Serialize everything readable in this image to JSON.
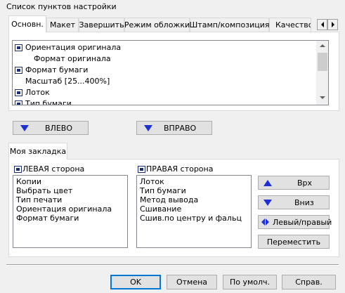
{
  "window": {
    "section_label": "Список пунктов настройки"
  },
  "tabs": [
    {
      "label": "Основн."
    },
    {
      "label": "Макет"
    },
    {
      "label": "Завершить"
    },
    {
      "label": "Режим обложки"
    },
    {
      "label": "Штамп/композиция"
    },
    {
      "label": "Качество"
    }
  ],
  "tab_scroll": {
    "left_icon": "chevron-left-icon",
    "right_icon": "chevron-right-icon"
  },
  "settings_list": {
    "items": [
      {
        "label": "Ориентация оригинала",
        "icon": "setting-item-icon"
      },
      {
        "label": "Формат оригинала",
        "icon": ""
      },
      {
        "label": "Формат бумаги",
        "icon": "setting-item-icon"
      },
      {
        "label": "Масштаб [25...400%]",
        "icon": ""
      },
      {
        "label": "Лоток",
        "icon": "setting-item-icon"
      },
      {
        "label": "Тип бумаги",
        "icon": "setting-item-icon"
      }
    ]
  },
  "move_buttons": {
    "left_label": "ВЛЕВО",
    "right_label": "ВПРАВО"
  },
  "bookmark": {
    "tab_label": "Моя закладка",
    "left_title": "ЛЕВАЯ сторона",
    "right_title": "ПРАВАЯ сторона",
    "left_items": [
      "Копии",
      "Выбрать цвет",
      "Тип печати",
      "Ориентация оригинала",
      "Формат бумаги"
    ],
    "right_items": [
      "Лоток",
      "Тип бумаги",
      "Метод вывода",
      "Сшивание",
      "Сшив.по центру и фальц"
    ],
    "up_label": "Врх",
    "down_label": "Вниз",
    "swap_label": "Левый/правый",
    "move_label": "Переместить"
  },
  "footer": {
    "ok_label": "OK",
    "cancel_label": "Отмена",
    "default_label": "По умолч.",
    "help_label": "Справ."
  }
}
